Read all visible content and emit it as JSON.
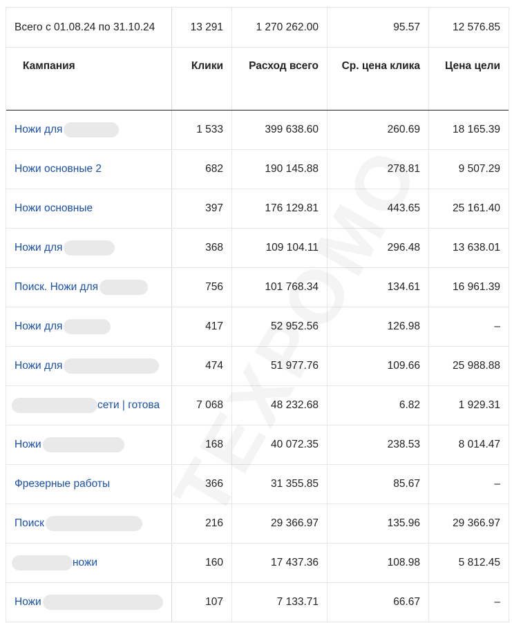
{
  "total": {
    "label": "Всего с 01.08.24 по 31.10.24",
    "clicks": "13 291",
    "spend": "1 270 262.00",
    "cpc": "95.57",
    "goal_price": "12 576.85"
  },
  "headers": {
    "campaign": "Кампания",
    "clicks": "Клики",
    "spend": "Расход всего",
    "cpc": "Ср. цена клика",
    "goal_price": "Цена цели"
  },
  "rows": [
    {
      "name_prefix": "Ножи для",
      "name_suffix": "",
      "clicks": "1 533",
      "spend": "399 638.60",
      "cpc": "260.69",
      "goal_price": "18 165.39"
    },
    {
      "name_prefix": "Ножи основные 2",
      "name_suffix": "",
      "clicks": "682",
      "spend": "190 145.88",
      "cpc": "278.81",
      "goal_price": "9 507.29"
    },
    {
      "name_prefix": "Ножи основные",
      "name_suffix": "",
      "clicks": "397",
      "spend": "176 129.81",
      "cpc": "443.65",
      "goal_price": "25 161.40"
    },
    {
      "name_prefix": "Ножи для",
      "name_suffix": "",
      "clicks": "368",
      "spend": "109 104.11",
      "cpc": "296.48",
      "goal_price": "13 638.01"
    },
    {
      "name_prefix": "Поиск. Ножи для",
      "name_suffix": "",
      "clicks": "756",
      "spend": "101 768.34",
      "cpc": "134.61",
      "goal_price": "16 961.39"
    },
    {
      "name_prefix": "Ножи для",
      "name_suffix": "",
      "clicks": "417",
      "spend": "52 952.56",
      "cpc": "126.98",
      "goal_price": "–"
    },
    {
      "name_prefix": "Ножи для",
      "name_suffix": "",
      "clicks": "474",
      "spend": "51 977.76",
      "cpc": "109.66",
      "goal_price": "25 988.88"
    },
    {
      "name_prefix": "",
      "name_suffix": "сети | готова",
      "clicks": "7 068",
      "spend": "48 232.68",
      "cpc": "6.82",
      "goal_price": "1 929.31"
    },
    {
      "name_prefix": "Ножи",
      "name_suffix": "",
      "clicks": "168",
      "spend": "40 072.35",
      "cpc": "238.53",
      "goal_price": "8 014.47"
    },
    {
      "name_prefix": "Фрезерные работы",
      "name_suffix": "",
      "clicks": "366",
      "spend": "31 355.85",
      "cpc": "85.67",
      "goal_price": "–"
    },
    {
      "name_prefix": "Поиск",
      "name_suffix": "",
      "clicks": "216",
      "spend": "29 366.97",
      "cpc": "135.96",
      "goal_price": "29 366.97"
    },
    {
      "name_prefix": "",
      "name_suffix": "ножи",
      "clicks": "160",
      "spend": "17 437.36",
      "cpc": "108.98",
      "goal_price": "5 812.45"
    },
    {
      "name_prefix": "Ножи",
      "name_suffix": "",
      "clicks": "107",
      "spend": "7 133.71",
      "cpc": "66.67",
      "goal_price": "–"
    }
  ],
  "watermark": "TEXPOMO",
  "colors": {
    "link": "#1a4fb0",
    "redaction": "#e9e9e9",
    "text": "#222222"
  }
}
